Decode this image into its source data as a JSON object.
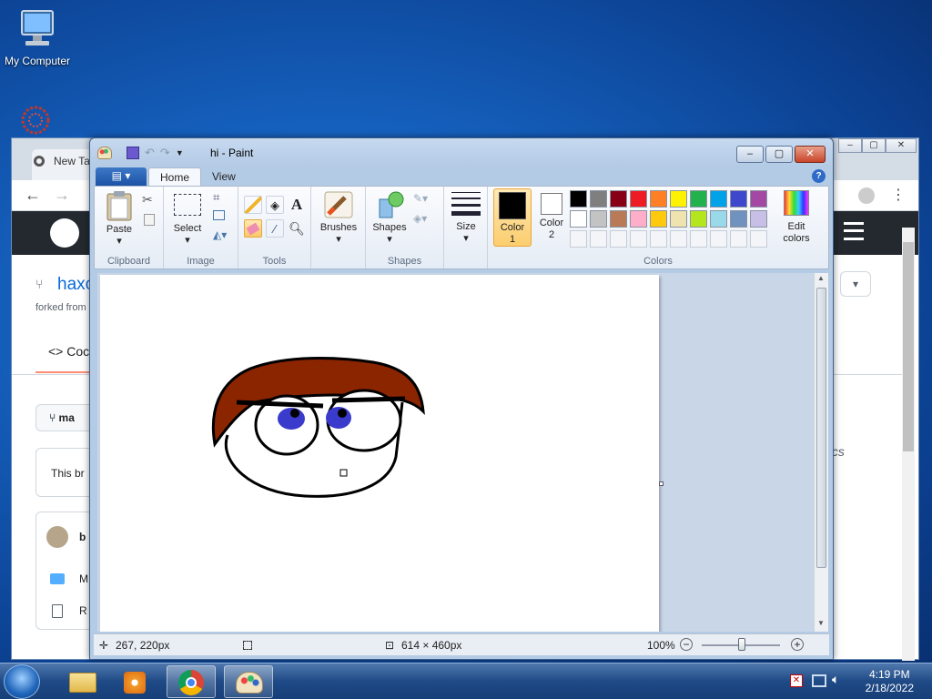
{
  "desktop": {
    "my_computer_label": "My Computer"
  },
  "chrome": {
    "tab_label": "New Ta",
    "repo_fragment": "haxc",
    "forked_fragment": "forked from",
    "code_tab": "Coc",
    "branch_fragment": "ma",
    "notice_fragment": "This br",
    "user_fragment": "b",
    "row1": "M",
    "row2": "R",
    "italic_fragment": "pics"
  },
  "paint": {
    "title": "hi - Paint",
    "tabs": {
      "home": "Home",
      "view": "View"
    },
    "clipboard": {
      "paste": "Paste",
      "label": "Clipboard"
    },
    "image": {
      "select": "Select",
      "label": "Image"
    },
    "tools": {
      "label": "Tools"
    },
    "brushes": {
      "label": "Brushes"
    },
    "shapes": {
      "label": "Shapes",
      "btn": "Shapes"
    },
    "size": {
      "label": "Size"
    },
    "colors": {
      "color1_a": "Color",
      "color1_b": "1",
      "color2_a": "Color",
      "color2_b": "2",
      "edit_a": "Edit",
      "edit_b": "colors",
      "label": "Colors",
      "palette_row1": [
        "#000000",
        "#7f7f7f",
        "#880015",
        "#ed1c24",
        "#ff7f27",
        "#fff200",
        "#22b14c",
        "#00a2e8",
        "#3f48cc",
        "#a349a4"
      ],
      "palette_row2": [
        "#ffffff",
        "#c3c3c3",
        "#b97a57",
        "#ffaec9",
        "#ffc90e",
        "#efe4b0",
        "#b5e61d",
        "#99d9ea",
        "#7092be",
        "#c8bfe7"
      ]
    },
    "status": {
      "cursor": "267, 220px",
      "size": "614 × 460px",
      "zoom": "100%"
    }
  },
  "taskbar": {
    "time": "4:19 PM",
    "date": "2/18/2022"
  }
}
